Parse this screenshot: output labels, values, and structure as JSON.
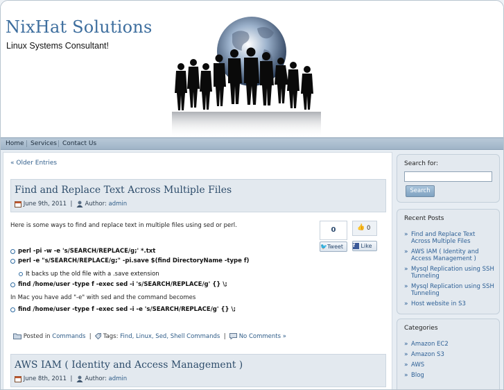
{
  "site": {
    "title": "NixHat Solutions",
    "tagline": "Linux Systems Consultant!"
  },
  "nav": [
    "Home",
    "Services",
    "Contact Us"
  ],
  "main": {
    "older_entries": "« Older Entries",
    "posts": [
      {
        "title": "Find and Replace Text Across Multiple Files",
        "date": "June 9th, 2011",
        "author_label": "Author:",
        "author": "admin",
        "intro": "Here is some ways to find and replace text in multiple files using sed or perl.",
        "list": [
          "perl -pi -w -e 's/SEARCH/REPLACE/g;' *.txt",
          "perl -e \"s/SEARCH/REPLACE/g;\" -pi.save $(find DirectoryName -type f)",
          "It backs up the old file with a .save extension",
          "find /home/user -type f -exec sed -i 's/SEARCH/REPLACE/g' {} \\;"
        ],
        "mac_note": "In Mac you have add \"-e\" with sed and the command becomes",
        "mac_cmd": "find /home/user -type f -exec sed -i -e 's/SEARCH/REPLACE/g' {} \\;",
        "posted_in_label": "Posted in",
        "category": "Commands",
        "tags_label": "Tags:",
        "tags": "Find, Linux, Sed, Shell Commands",
        "comments": "No Comments »",
        "share": {
          "tweet_count": "0",
          "tweet_label": "Tweet",
          "like_count": "0",
          "like_label": "Like"
        }
      },
      {
        "title": "AWS IAM ( Identity and Access Management )",
        "date": "June 8th, 2011",
        "author_label": "Author:",
        "author": "admin"
      }
    ]
  },
  "sidebar": {
    "search": {
      "label": "Search for:",
      "value": "",
      "button": "Search"
    },
    "recent_posts": {
      "title": "Recent Posts",
      "items": [
        "Find and Replace Text Across Multiple Files",
        "AWS IAM ( Identity and Access Management )",
        "Mysql Replication using SSH Tunneling",
        "Mysql Replication using SSH Tunneling",
        "Host website in S3"
      ]
    },
    "categories": {
      "title": "Categories",
      "items": [
        "Amazon EC2",
        "Amazon S3",
        "AWS",
        "Blog"
      ]
    }
  },
  "colors": {
    "title": "#3d6e9e",
    "link": "#2c5f95",
    "nav_bg": "#b9c9d8",
    "post_head_bg": "#e3e9ef"
  }
}
